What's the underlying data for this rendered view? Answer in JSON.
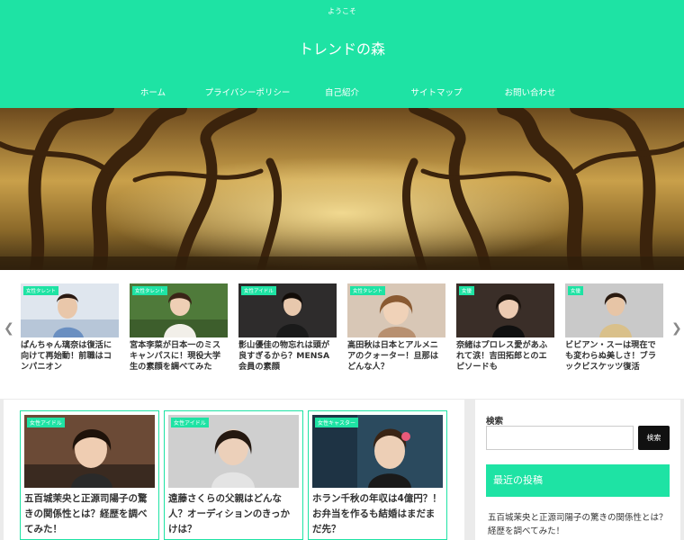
{
  "header": {
    "tagline": "ようこそ",
    "site_title": "トレンドの森",
    "nav": [
      "ホーム",
      "プライバシーポリシー",
      "自己紹介",
      "サイトマップ",
      "お問い合わせ"
    ]
  },
  "colors": {
    "accent": "#1ee3a4",
    "dark_button": "#111111",
    "page_bg": "#ebebeb"
  },
  "carousel": {
    "prev_icon": "chevron-left-icon",
    "next_icon": "chevron-right-icon",
    "cards": [
      {
        "badge": "女性タレント",
        "title": "ぱんちゃん璃奈は復活に向けて再始動！前職はコンパニオン"
      },
      {
        "badge": "女性タレント",
        "title": "宮本李菜が日本一のミスキャンパスに！現役大学生の素顔を調べてみた"
      },
      {
        "badge": "女性アイドル",
        "title": "影山優佳の物忘れは頭が良すぎるから？MENSA会員の素顔"
      },
      {
        "badge": "女性タレント",
        "title": "高田秋は日本とアルメニアのクォーター！旦那はどんな人？"
      },
      {
        "badge": "女優",
        "title": "奈緒はプロレス愛があふれて涙！吉田拓郎とのエピソードも"
      },
      {
        "badge": "女優",
        "title": "ビビアン・スーは現在でも変わらぬ美しさ！ブラックビスケッツ復活"
      }
    ],
    "dots_count": 3,
    "active_dot": 1
  },
  "posts": [
    {
      "badge": "女性アイドル",
      "title": "五百城茉央と正源司陽子の驚きの関係性とは？経歴を調べてみた！"
    },
    {
      "badge": "女性アイドル",
      "title": "遠藤さくらの父親はどんな人？オーディションのきっかけは？"
    },
    {
      "badge": "女性キャスター",
      "title": "ホラン千秋の年収は4億円？！お弁当を作るも結婚はまだまだ先？"
    }
  ],
  "sidebar": {
    "search_label": "検索",
    "search_value": "",
    "search_button": "検索",
    "recent_heading": "最近の投稿",
    "recent_posts": [
      "五百城茉央と正源司陽子の驚きの関係性とは？経歴を調べてみた！"
    ]
  }
}
